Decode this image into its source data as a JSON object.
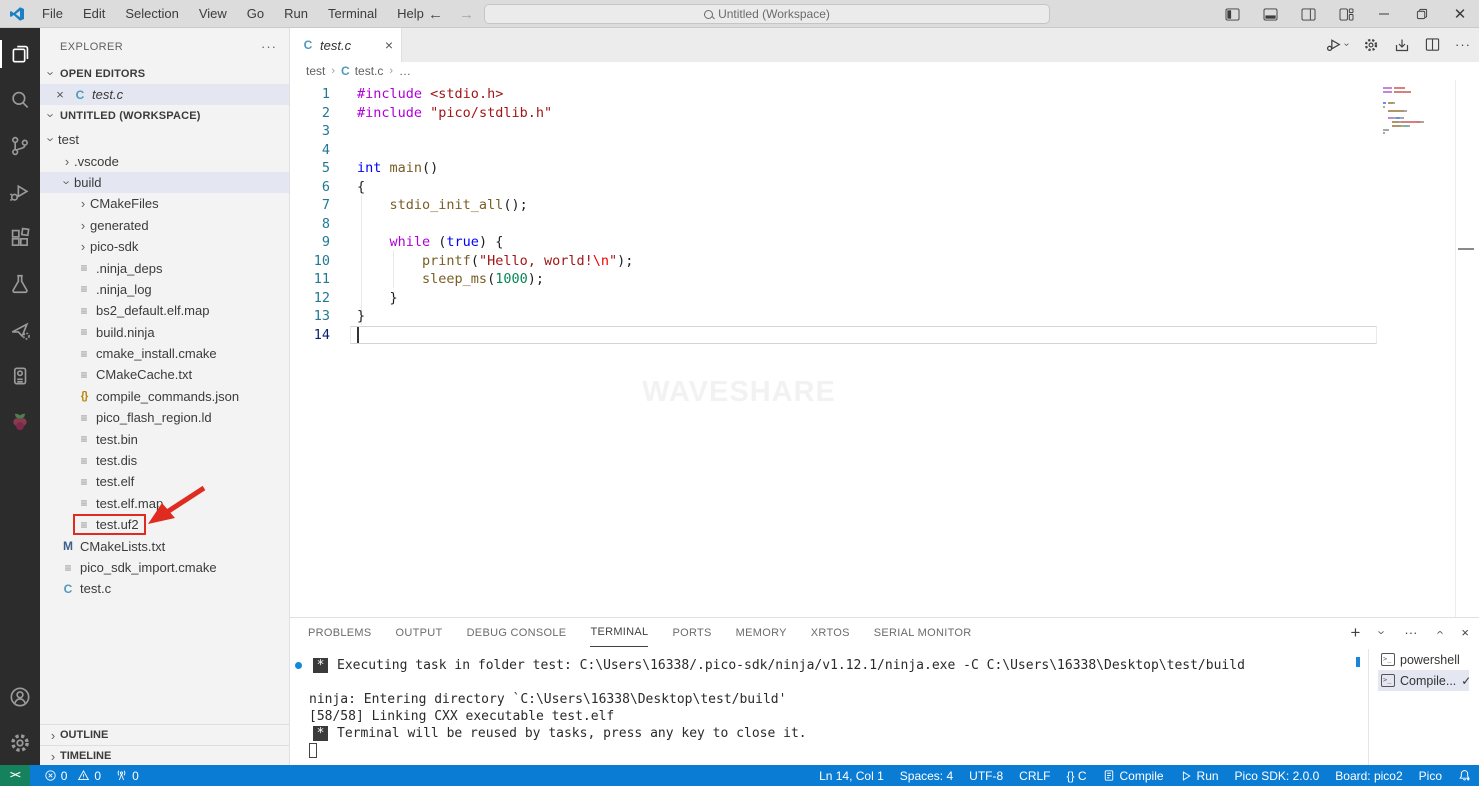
{
  "titlebar": {
    "menus": [
      "File",
      "Edit",
      "Selection",
      "View",
      "Go",
      "Run",
      "Terminal",
      "Help"
    ],
    "nav": {
      "back": "←",
      "forward": "→"
    },
    "search_text": "Untitled (Workspace)",
    "window_controls": [
      "layout-sidebar-left",
      "layout-panel",
      "layout-sidebar-right",
      "customize-layout",
      "minimize",
      "restore",
      "close"
    ]
  },
  "activity_bar": {
    "items": [
      "explorer",
      "search",
      "source-control",
      "run-and-debug",
      "extensions",
      "testing",
      "cmake-tools",
      "pico-pinout",
      "raspberry-pi"
    ],
    "active": "explorer",
    "bottom_items": [
      "accounts",
      "settings"
    ]
  },
  "sidebar": {
    "title": "EXPLORER",
    "more": "···",
    "open_editors": {
      "label": "OPEN EDITORS",
      "item": {
        "close": "×",
        "icon": "C",
        "label": "test.c"
      }
    },
    "workspace_label": "UNTITLED (WORKSPACE)",
    "tree": [
      {
        "label": "test",
        "depth": 0,
        "icon": "chev-down"
      },
      {
        "label": ".vscode",
        "depth": 1,
        "icon": "chev-right"
      },
      {
        "label": "build",
        "depth": 1,
        "icon": "chev-down",
        "selected": true
      },
      {
        "label": "CMakeFiles",
        "depth": 2,
        "icon": "chev-right"
      },
      {
        "label": "generated",
        "depth": 2,
        "icon": "chev-right"
      },
      {
        "label": "pico-sdk",
        "depth": 2,
        "icon": "chev-right"
      },
      {
        "label": ".ninja_deps",
        "depth": 2,
        "icon": "file"
      },
      {
        "label": ".ninja_log",
        "depth": 2,
        "icon": "file"
      },
      {
        "label": "bs2_default.elf.map",
        "depth": 2,
        "icon": "file"
      },
      {
        "label": "build.ninja",
        "depth": 2,
        "icon": "file"
      },
      {
        "label": "cmake_install.cmake",
        "depth": 2,
        "icon": "file"
      },
      {
        "label": "CMakeCache.txt",
        "depth": 2,
        "icon": "file"
      },
      {
        "label": "compile_commands.json",
        "depth": 2,
        "icon": "json"
      },
      {
        "label": "pico_flash_region.ld",
        "depth": 2,
        "icon": "file"
      },
      {
        "label": "test.bin",
        "depth": 2,
        "icon": "file"
      },
      {
        "label": "test.dis",
        "depth": 2,
        "icon": "file"
      },
      {
        "label": "test.elf",
        "depth": 2,
        "icon": "file"
      },
      {
        "label": "test.elf.map",
        "depth": 2,
        "icon": "file"
      },
      {
        "label": "test.uf2",
        "depth": 2,
        "icon": "file",
        "annotated": true
      },
      {
        "label": "CMakeLists.txt",
        "depth": 1,
        "icon": "cmake"
      },
      {
        "label": "pico_sdk_import.cmake",
        "depth": 1,
        "icon": "file"
      },
      {
        "label": "test.c",
        "depth": 1,
        "icon": "c"
      }
    ],
    "outline_label": "OUTLINE",
    "timeline_label": "TIMELINE"
  },
  "editor": {
    "tab": {
      "icon": "C",
      "label": "test.c",
      "close": "×"
    },
    "actions": [
      "run-or-debug",
      "settings-gear",
      "flash-project",
      "split-editor",
      "more-actions"
    ],
    "breadcrumb": [
      "test",
      "test.c",
      "…"
    ],
    "active_line": 14,
    "watermark": "WAVESHARE",
    "code_lines": [
      [
        [
          "pp",
          "#include"
        ],
        [
          "pl",
          " "
        ],
        [
          "str",
          "<stdio.h>"
        ]
      ],
      [
        [
          "pp",
          "#include"
        ],
        [
          "pl",
          " "
        ],
        [
          "str",
          "\"pico/stdlib.h\""
        ]
      ],
      [],
      [],
      [
        [
          "ty",
          "int"
        ],
        [
          "pl",
          " "
        ],
        [
          "fn",
          "main"
        ],
        [
          "pl",
          "()"
        ]
      ],
      [
        [
          "pl",
          "{"
        ]
      ],
      [
        [
          "pl",
          "    "
        ],
        [
          "fn",
          "stdio_init_all"
        ],
        [
          "pl",
          "();"
        ]
      ],
      [],
      [
        [
          "pl",
          "    "
        ],
        [
          "kw",
          "while"
        ],
        [
          "pl",
          " ("
        ],
        [
          "ty",
          "true"
        ],
        [
          "pl",
          ") {"
        ]
      ],
      [
        [
          "pl",
          "        "
        ],
        [
          "fn",
          "printf"
        ],
        [
          "pl",
          "("
        ],
        [
          "str",
          "\"Hello, world!"
        ],
        [
          "esc",
          "\\n"
        ],
        [
          "str",
          "\""
        ],
        [
          "pl",
          ");"
        ]
      ],
      [
        [
          "pl",
          "        "
        ],
        [
          "fn",
          "sleep_ms"
        ],
        [
          "pl",
          "("
        ],
        [
          "num",
          "1000"
        ],
        [
          "pl",
          ");"
        ]
      ],
      [
        [
          "pl",
          "    }"
        ]
      ],
      [
        [
          "pl",
          "}"
        ]
      ],
      []
    ]
  },
  "panel": {
    "tabs": [
      {
        "label": "PROBLEMS"
      },
      {
        "label": "OUTPUT"
      },
      {
        "label": "DEBUG CONSOLE"
      },
      {
        "label": "TERMINAL",
        "active": true
      },
      {
        "label": "PORTS"
      },
      {
        "label": "MEMORY"
      },
      {
        "label": "XRTOS"
      },
      {
        "label": "SERIAL MONITOR"
      }
    ],
    "actions": {
      "new": "+",
      "dropdown": "›",
      "more": "···",
      "maximize": "›",
      "close": "×"
    },
    "terminal_lines": [
      {
        "decor": true,
        "star": true,
        "text": "Executing task in folder test: C:\\Users\\16338/.pico-sdk/ninja/v1.12.1/ninja.exe -C C:\\Users\\16338\\Desktop\\test/build"
      },
      {
        "text": ""
      },
      {
        "text": "ninja: Entering directory `C:\\Users\\16338\\Desktop\\test/build'"
      },
      {
        "text": "[58/58] Linking CXX executable test.elf"
      },
      {
        "star": true,
        "text": "Terminal will be reused by tasks, press any key to close it."
      },
      {
        "cursor": true
      }
    ],
    "terminal_list": [
      {
        "label": "powershell"
      },
      {
        "label": "Compile...",
        "selected": true,
        "check": "✓"
      }
    ]
  },
  "status_bar": {
    "remote_text": "><",
    "errors": "0",
    "warnings": "0",
    "ports": "0",
    "right_items": [
      {
        "label": "Ln 14, Col 1",
        "name": "cursor-position"
      },
      {
        "label": "Spaces: 4",
        "name": "indentation"
      },
      {
        "label": "UTF-8",
        "name": "encoding"
      },
      {
        "label": "CRLF",
        "name": "eol"
      },
      {
        "label": "{} C",
        "name": "language-mode"
      },
      {
        "label": "Compile",
        "icon": "compile",
        "name": "compile-button"
      },
      {
        "label": "Run",
        "icon": "run",
        "name": "run-button"
      },
      {
        "label": "Pico SDK: 2.0.0",
        "name": "pico-sdk-version"
      },
      {
        "label": "Board: pico2",
        "name": "board"
      },
      {
        "label": "Pico",
        "name": "pico"
      },
      {
        "icon": "bell",
        "label": "",
        "name": "notifications-bell"
      }
    ]
  }
}
